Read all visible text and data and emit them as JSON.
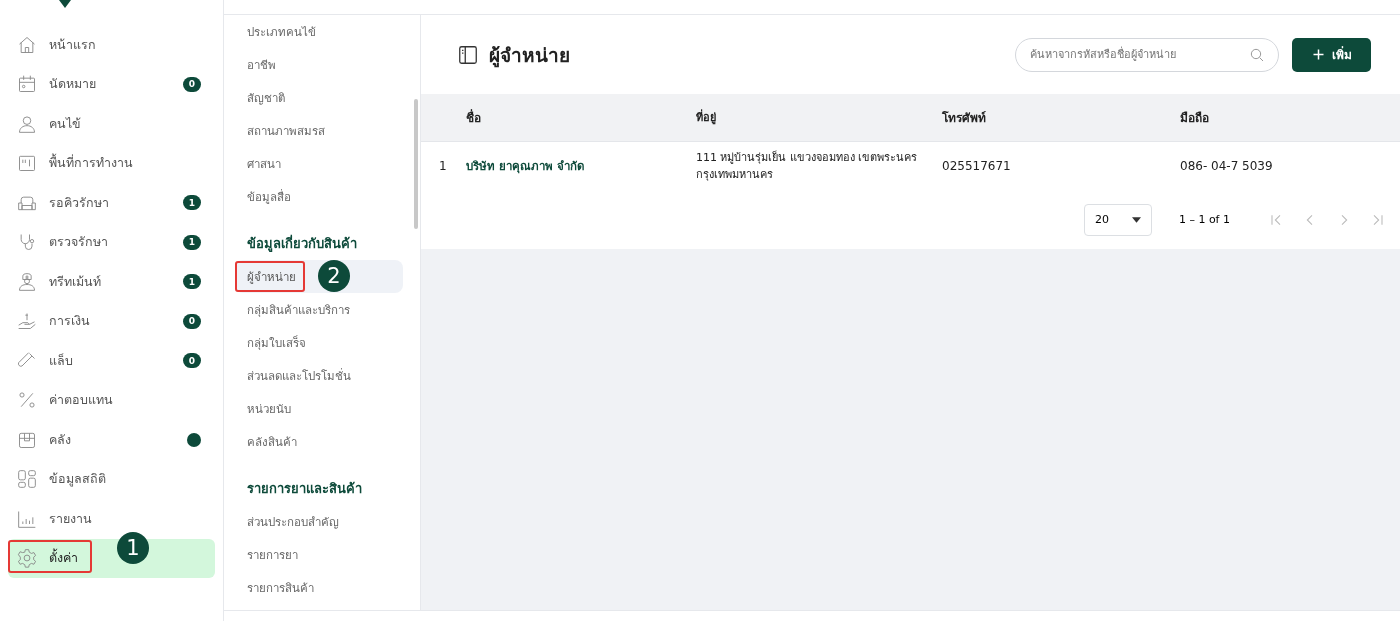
{
  "sidebar": {
    "items": [
      {
        "label": "หน้าแรก",
        "selected": false
      },
      {
        "label": "นัดหมาย",
        "badge": "0",
        "selected": false
      },
      {
        "label": "คนไข้",
        "selected": false
      },
      {
        "label": "พื้นที่การทำงาน",
        "selected": false
      },
      {
        "label": "รอคิวรักษา",
        "badge": "1",
        "selected": false
      },
      {
        "label": "ตรวจรักษา",
        "badge": "1",
        "selected": false
      },
      {
        "label": "ทรีทเม้นท์",
        "badge": "1",
        "selected": false
      },
      {
        "label": "การเงิน",
        "badge": "0",
        "selected": false
      },
      {
        "label": "แล็บ",
        "badge": "0",
        "selected": false
      },
      {
        "label": "ค่าตอบแทน",
        "selected": false
      },
      {
        "label": "คลัง",
        "dot": true,
        "selected": false
      },
      {
        "label": "ข้อมูลสถิติ",
        "selected": false
      },
      {
        "label": "รายงาน",
        "selected": false
      },
      {
        "label": "ตั้งค่า",
        "selected": true,
        "callout": "1"
      }
    ]
  },
  "submenu": {
    "sections": [
      {
        "items": [
          {
            "label": "ประเภทคนไข้",
            "selected": false
          },
          {
            "label": "อาชีพ",
            "selected": false
          },
          {
            "label": "สัญชาติ",
            "selected": false
          },
          {
            "label": "สถานภาพสมรส",
            "selected": false
          },
          {
            "label": "ศาสนา",
            "selected": false
          },
          {
            "label": "ข้อมูลสื่อ",
            "selected": false
          }
        ]
      },
      {
        "heading": "ข้อมูลเกี่ยวกับสินค้า",
        "items": [
          {
            "label": "ผู้จำหน่าย",
            "selected": true,
            "callout": "2"
          },
          {
            "label": "กลุ่มสินค้าและบริการ",
            "selected": false
          },
          {
            "label": "กลุ่มใบเสร็จ",
            "selected": false
          },
          {
            "label": "ส่วนลดและโปรโมชั่น",
            "selected": false
          },
          {
            "label": "หน่วยนับ",
            "selected": false
          },
          {
            "label": "คลังสินค้า",
            "selected": false
          }
        ]
      },
      {
        "heading": "รายการยาและสินค้า",
        "items": [
          {
            "label": "ส่วนประกอบสำคัญ",
            "selected": false
          },
          {
            "label": "รายการยา",
            "selected": false
          },
          {
            "label": "รายการสินค้า",
            "selected": false
          }
        ]
      }
    ]
  },
  "page": {
    "title": "ผู้จำหน่าย",
    "search": {
      "placeholder": "ค้นหาจากรหัสหรือชื่อผู้จำหน่าย"
    },
    "add_button": "เพิ่ม"
  },
  "table": {
    "columns": [
      "ชื่อ",
      "ที่อยู่",
      "โทรศัพท์",
      "มือถือ"
    ],
    "rows": [
      {
        "index": "1",
        "name": "บริษัท ยาคุณภาพ จำกัด",
        "address": [
          "111 หมู่บ้านรุ่มเย็น แขวงจอมทอง เขตพระนคร",
          "กรุงเทพมหานคร"
        ],
        "phone": "025517671",
        "mobile": "086- 04-7 5039"
      }
    ]
  },
  "pagination": {
    "page_size": "20",
    "range": "1 – 1 of 1"
  }
}
